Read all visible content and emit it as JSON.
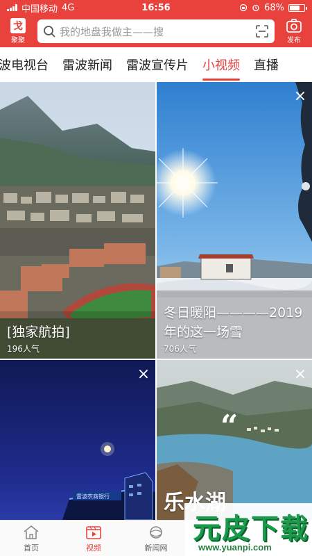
{
  "status_bar": {
    "carrier": "中国移动",
    "network": "4G",
    "time": "16:56",
    "battery": "68%",
    "battery_level": 0.68
  },
  "header": {
    "logo_label": "聚聚",
    "logo_glyph": "戈",
    "search_placeholder": "我的地盘我做主——搜",
    "publish_label": "发布",
    "accent_color": "#e9423d"
  },
  "tabs": [
    {
      "label": "波电视台",
      "active": false
    },
    {
      "label": "雷波新闻",
      "active": false
    },
    {
      "label": "雷波宣传片",
      "active": false
    },
    {
      "label": "小视频",
      "active": true
    },
    {
      "label": "直播",
      "active": false
    }
  ],
  "videos": [
    {
      "title": "[独家航拍]",
      "views": "196人气",
      "close": "×"
    },
    {
      "title": "冬日暖阳————2019年的这一场雪",
      "views": "706人气",
      "close": "×"
    },
    {
      "title": "",
      "views": "",
      "close": "×"
    },
    {
      "title": "",
      "views": "",
      "close": "×",
      "overlay_text": "乐水湖"
    }
  ],
  "bottom_nav": [
    {
      "label": "首页",
      "icon": "home-icon",
      "active": false
    },
    {
      "label": "视频",
      "icon": "video-icon",
      "active": true
    },
    {
      "label": "新闻网",
      "icon": "news-globe-icon",
      "active": false
    }
  ],
  "watermark": {
    "brand": "元皮下载",
    "url": "www.yuanpi.com"
  }
}
